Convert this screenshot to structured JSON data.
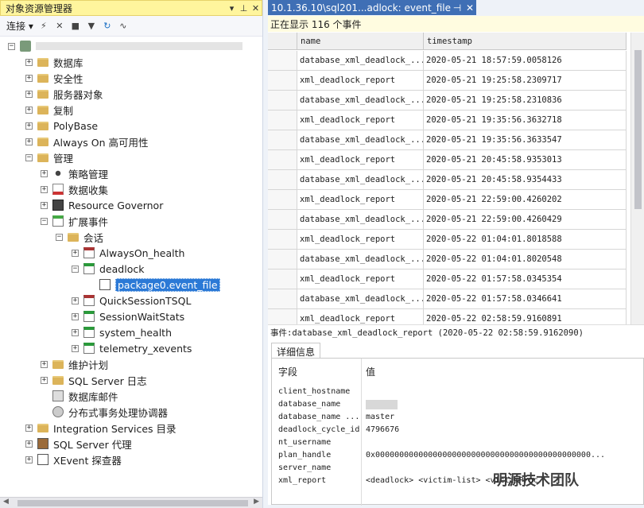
{
  "left_panel": {
    "title": "对象资源管理器",
    "title_buttons": [
      "▾",
      "📌",
      "✕"
    ],
    "toolbar": {
      "connect_label": "连接",
      "connect_arrow": "▾"
    },
    "server_node": {
      "label_placeholder": ""
    },
    "tree": [
      {
        "label": "数据库",
        "depth": 1,
        "icon": "folder-icon",
        "exp": "+"
      },
      {
        "label": "安全性",
        "depth": 1,
        "icon": "folder-icon",
        "exp": "+"
      },
      {
        "label": "服务器对象",
        "depth": 1,
        "icon": "folder-icon",
        "exp": "+"
      },
      {
        "label": "复制",
        "depth": 1,
        "icon": "folder-icon",
        "exp": "+"
      },
      {
        "label": "PolyBase",
        "depth": 1,
        "icon": "folder-icon",
        "exp": "+"
      },
      {
        "label": "Always On 高可用性",
        "depth": 1,
        "icon": "folder-icon",
        "exp": "+"
      },
      {
        "label": "管理",
        "depth": 1,
        "icon": "folder-icon",
        "exp": "−"
      },
      {
        "label": "策略管理",
        "depth": 2,
        "icon": "policy-icon",
        "exp": "+"
      },
      {
        "label": "数据收集",
        "depth": 2,
        "icon": "data-collection-icon",
        "exp": "+"
      },
      {
        "label": "Resource Governor",
        "depth": 2,
        "icon": "resource-governor-icon",
        "exp": "+"
      },
      {
        "label": "扩展事件",
        "depth": 2,
        "icon": "extended-events-icon",
        "exp": "−"
      },
      {
        "label": "会话",
        "depth": 3,
        "icon": "folder-icon",
        "exp": "−"
      },
      {
        "label": "AlwaysOn_health",
        "depth": 4,
        "icon": "session-stopped-icon",
        "exp": "+"
      },
      {
        "label": "deadlock",
        "depth": 4,
        "icon": "session-running-icon",
        "exp": "−"
      },
      {
        "label": "package0.event_file",
        "depth": 5,
        "icon": "event-file-icon",
        "exp": "",
        "selected": true
      },
      {
        "label": "QuickSessionTSQL",
        "depth": 4,
        "icon": "session-stopped-icon",
        "exp": "+"
      },
      {
        "label": "SessionWaitStats",
        "depth": 4,
        "icon": "session-running-icon",
        "exp": "+"
      },
      {
        "label": "system_health",
        "depth": 4,
        "icon": "session-running-icon",
        "exp": "+"
      },
      {
        "label": "telemetry_xevents",
        "depth": 4,
        "icon": "session-running-icon",
        "exp": "+"
      },
      {
        "label": "维护计划",
        "depth": 2,
        "icon": "folder-icon",
        "exp": "+"
      },
      {
        "label": "SQL Server 日志",
        "depth": 2,
        "icon": "folder-icon",
        "exp": "+"
      },
      {
        "label": "数据库邮件",
        "depth": 2,
        "icon": "database-mail-icon",
        "exp": ""
      },
      {
        "label": "分布式事务处理协调器",
        "depth": 2,
        "icon": "dtc-icon",
        "exp": ""
      },
      {
        "label": "Integration Services 目录",
        "depth": 1,
        "icon": "folder-icon",
        "exp": "+"
      },
      {
        "label": "SQL Server 代理",
        "depth": 1,
        "icon": "sql-agent-icon",
        "exp": "+"
      },
      {
        "label": "XEvent 探查器",
        "depth": 1,
        "icon": "xevent-profiler-icon",
        "exp": "+"
      }
    ]
  },
  "document": {
    "tab_title": "10.1.36.10\\sql201...adlock: event_file",
    "tab_pin": "⊣",
    "tab_close": "✕",
    "status_text": "正在显示 116 个事件",
    "columns": [
      "name",
      "timestamp"
    ],
    "rows": [
      [
        "database_xml_deadlock_...",
        "2020-05-21 18:57:59.0058126"
      ],
      [
        "xml_deadlock_report",
        "2020-05-21 19:25:58.2309717"
      ],
      [
        "database_xml_deadlock_...",
        "2020-05-21 19:25:58.2310836"
      ],
      [
        "xml_deadlock_report",
        "2020-05-21 19:35:56.3632718"
      ],
      [
        "database_xml_deadlock_...",
        "2020-05-21 19:35:56.3633547"
      ],
      [
        "xml_deadlock_report",
        "2020-05-21 20:45:58.9353013"
      ],
      [
        "database_xml_deadlock_...",
        "2020-05-21 20:45:58.9354433"
      ],
      [
        "xml_deadlock_report",
        "2020-05-21 22:59:00.4260202"
      ],
      [
        "database_xml_deadlock_...",
        "2020-05-21 22:59:00.4260429"
      ],
      [
        "xml_deadlock_report",
        "2020-05-22 01:04:01.8018588"
      ],
      [
        "database_xml_deadlock_...",
        "2020-05-22 01:04:01.8020548"
      ],
      [
        "xml_deadlock_report",
        "2020-05-22 01:57:58.0345354"
      ],
      [
        "database_xml_deadlock_...",
        "2020-05-22 01:57:58.0346641"
      ],
      [
        "xml_deadlock_report",
        "2020-05-22 02:58:59.9160891"
      ]
    ],
    "event_line": "事件:database_xml_deadlock_report (2020-05-22 02:58:59.9162090)",
    "details_tab": "详细信息",
    "details_headers": {
      "field": "字段",
      "value": "值"
    },
    "details": [
      {
        "key": "client_hostname",
        "value": "",
        "blurred": false
      },
      {
        "key": "database_name",
        "value": "",
        "blurred": true
      },
      {
        "key": "database_name ...",
        "value": "master",
        "blurred": false
      },
      {
        "key": "deadlock_cycle_id",
        "value": "4796676",
        "blurred": false
      },
      {
        "key": "nt_username",
        "value": "",
        "blurred": false
      },
      {
        "key": "plan_handle",
        "value": "0x000000000000000000000000000000000000000000000...",
        "blurred": false
      },
      {
        "key": "server_name",
        "value": "",
        "blurred": false
      },
      {
        "key": "xml_report",
        "value": "<deadlock>  <victim-list>  <victimProc",
        "blurred": false
      }
    ],
    "watermark": "明源技术团队"
  }
}
